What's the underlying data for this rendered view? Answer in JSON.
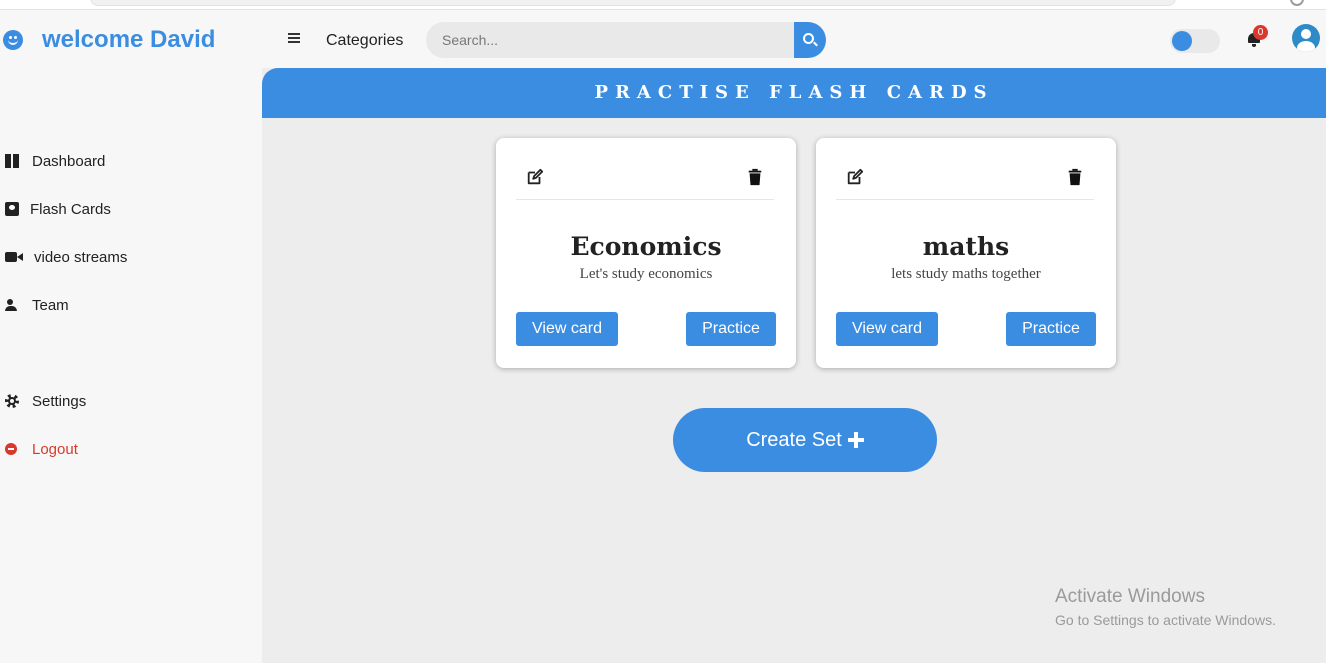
{
  "header": {
    "brand_title": "welcome David",
    "categories_label": "Categories",
    "search_placeholder": "Search...",
    "notification_count": "0",
    "accent_color": "#3b8de2"
  },
  "sidebar": {
    "items": [
      {
        "label": "Dashboard",
        "icon": "dashboard-icon"
      },
      {
        "label": "Flash Cards",
        "icon": "flashcards-icon"
      },
      {
        "label": "video streams",
        "icon": "video-icon"
      },
      {
        "label": "Team",
        "icon": "team-icon"
      },
      {
        "label": "Settings",
        "icon": "gear-icon"
      },
      {
        "label": "Logout",
        "icon": "logout-icon"
      }
    ]
  },
  "main": {
    "banner_title": "PRACTISE FLASH CARDS",
    "cards": [
      {
        "title": "Economics",
        "description": "Let's study economics",
        "view_label": "View card",
        "practice_label": "Practice"
      },
      {
        "title": "maths",
        "description": "lets study maths together",
        "view_label": "View card",
        "practice_label": "Practice"
      }
    ],
    "create_label": "Create Set"
  },
  "watermark": {
    "line1": "Activate Windows",
    "line2": "Go to Settings to activate Windows."
  }
}
